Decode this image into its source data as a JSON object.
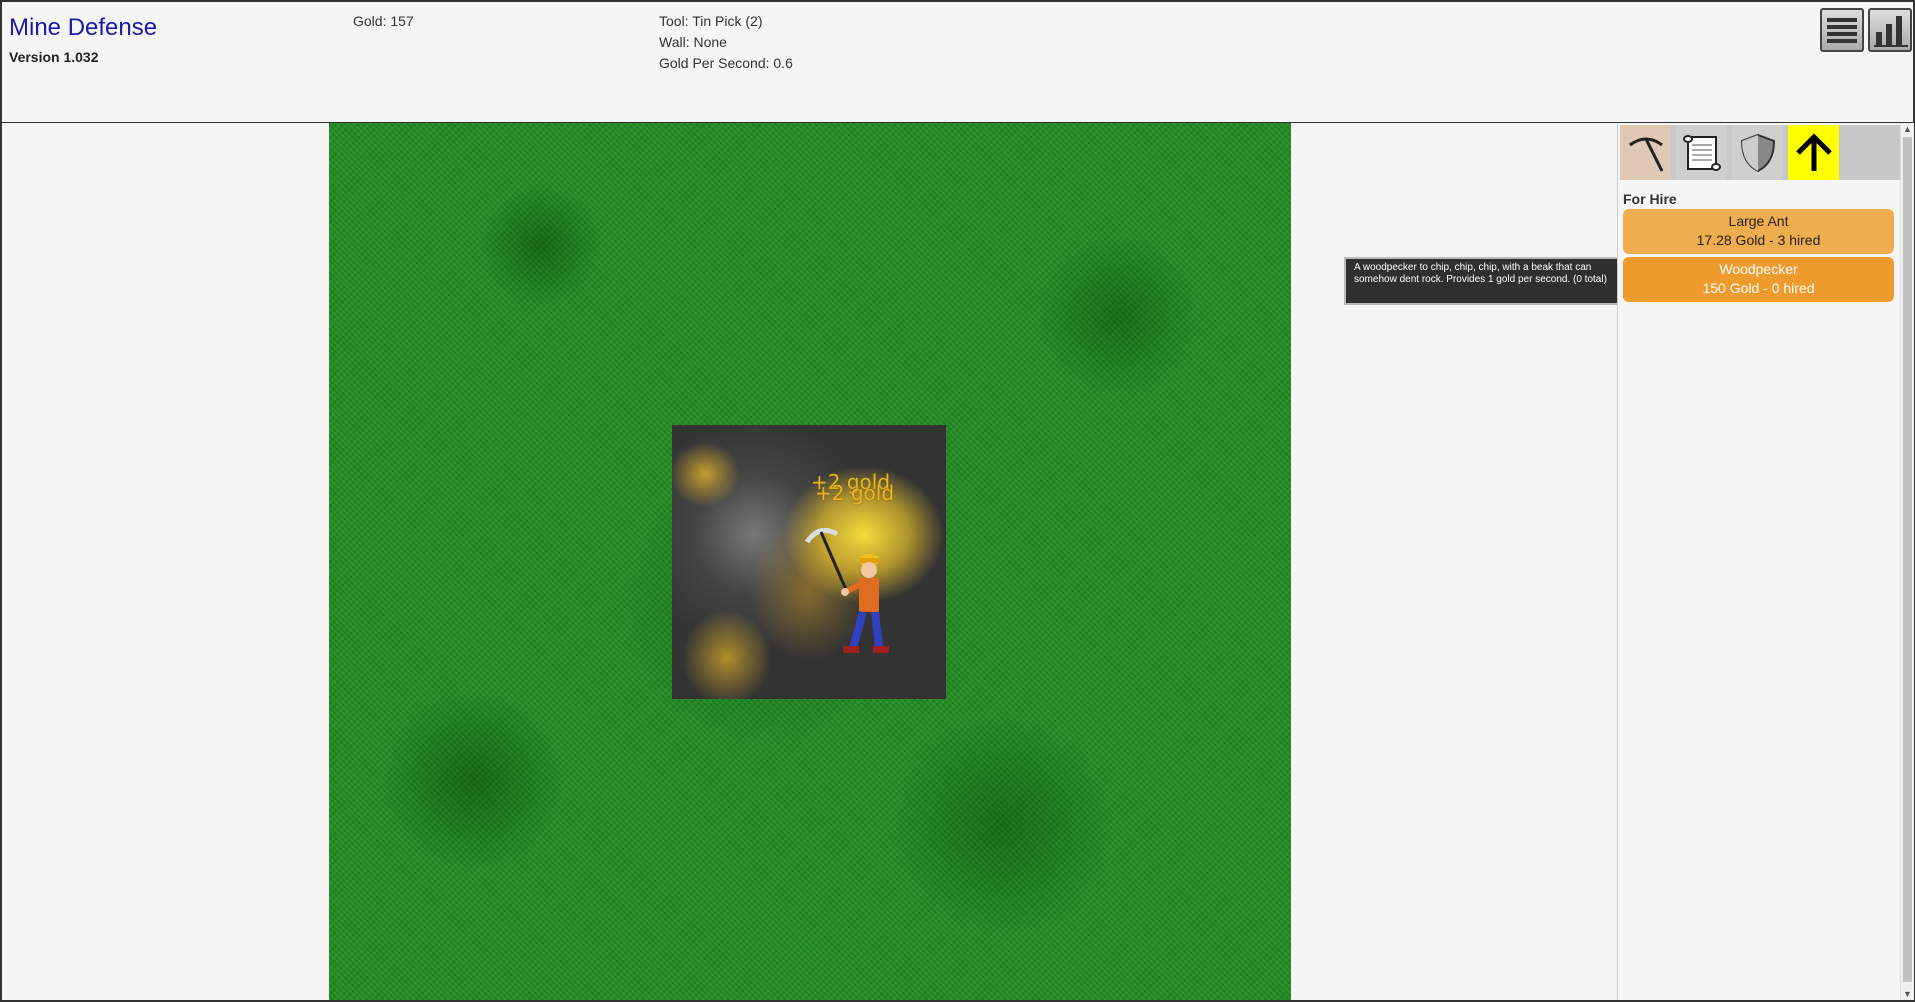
{
  "header": {
    "title": "Mine Defense",
    "version": "Version 1.032",
    "gold": "Gold: 157",
    "tool": "Tool: Tin Pick (2)",
    "wall": "Wall: None",
    "gps": "Gold Per Second: 0.6"
  },
  "field": {
    "floating_texts": [
      "+2 gold",
      "+2 gold"
    ]
  },
  "tooltip": {
    "text": "A woodpecker to chip, chip, chip, with a beak that can somehow dent rock. Provides 1 gold per second. (0 total)"
  },
  "panel": {
    "tabs": [
      {
        "icon": "pickaxe-icon"
      },
      {
        "icon": "scroll-icon"
      },
      {
        "icon": "shield-icon"
      },
      {
        "icon": "up-arrow-icon"
      }
    ],
    "section_label": "For Hire",
    "hires": [
      {
        "name": "Large Ant",
        "detail": "17.28 Gold - 3 hired"
      },
      {
        "name": "Woodpecker",
        "detail": "150 Gold - 0 hired"
      }
    ]
  },
  "colors": {
    "title": "#1a1aa8",
    "hire_button": "#f0ad4e",
    "hire_button_hover": "#ef9a2c",
    "upgrade_tab": "#ffff00",
    "grass": "#1f8a1f"
  }
}
